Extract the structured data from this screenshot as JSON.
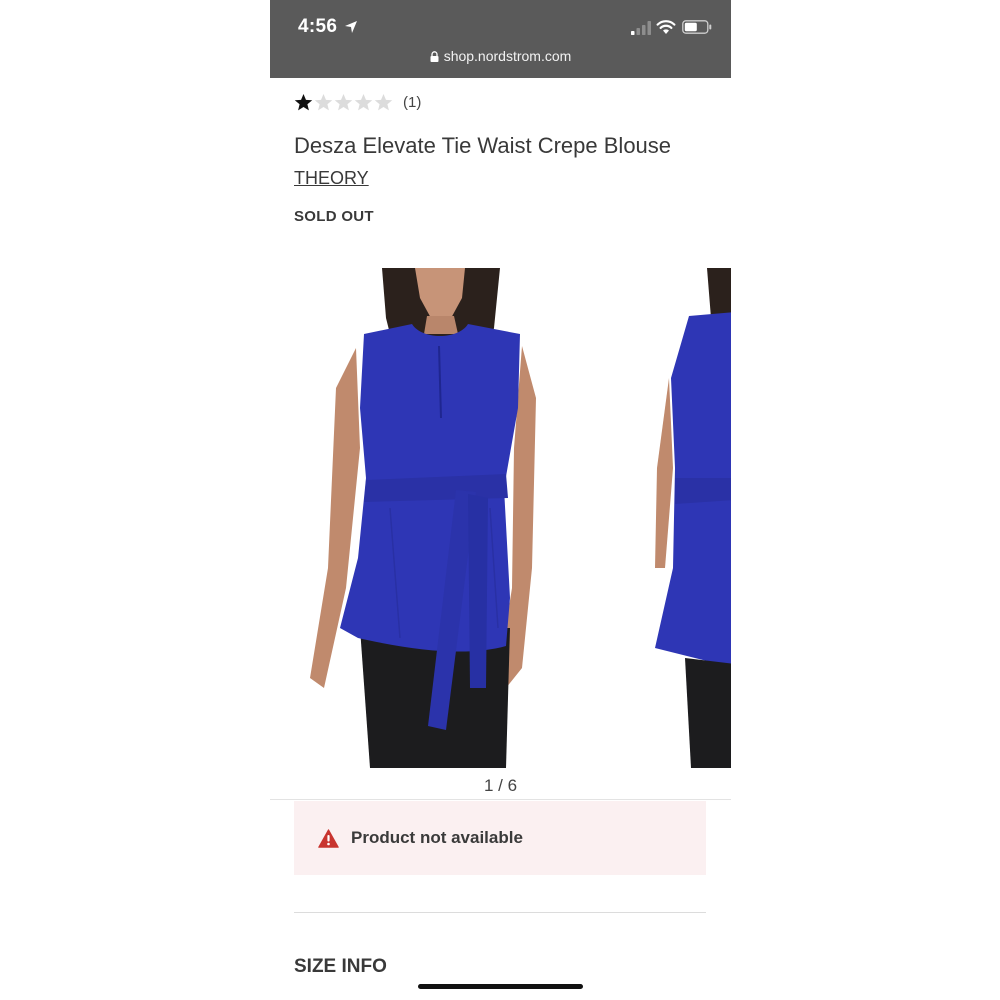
{
  "status_bar": {
    "time": "4:56",
    "url": "shop.nordstrom.com"
  },
  "product": {
    "rating": 1,
    "rating_max": 5,
    "rating_count": "(1)",
    "title": "Desza Elevate Tie Waist Crepe Blouse",
    "brand": "THEORY",
    "availability": "SOLD OUT"
  },
  "gallery": {
    "pager": "1 / 6"
  },
  "alert": {
    "message": "Product not available"
  },
  "section": {
    "size_info": "SIZE INFO"
  },
  "colors": {
    "status_bar_bg": "#5a5a5a",
    "alert_bg": "#fbf0f1",
    "alert_icon": "#c8342f",
    "blouse": "#2e36b5"
  }
}
